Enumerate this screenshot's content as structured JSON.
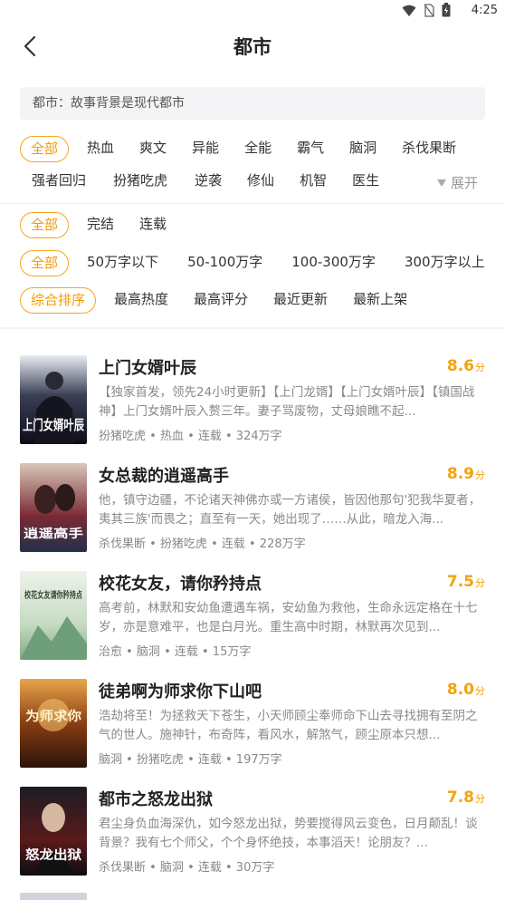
{
  "status": {
    "time": "4:25"
  },
  "header": {
    "title": "都市"
  },
  "description": "都市：故事背景是现代都市",
  "genre_tags": [
    "全部",
    "热血",
    "爽文",
    "异能",
    "全能",
    "霸气",
    "脑洞",
    "杀伐果断",
    "强者回归",
    "扮猪吃虎",
    "逆袭",
    "修仙",
    "机智",
    "医生"
  ],
  "expand_label": "展开",
  "status_filters": [
    "全部",
    "完结",
    "连载"
  ],
  "length_filters": [
    "全部",
    "50万字以下",
    "50-100万字",
    "100-300万字",
    "300万字以上"
  ],
  "sort_filters": [
    "综合排序",
    "最高热度",
    "最高评分",
    "最近更新",
    "最新上架"
  ],
  "score_unit": "分",
  "books": [
    {
      "title": "上门女婿叶辰",
      "score": "8.6",
      "desc": "【独家首发，领先24小时更新】【上门龙婿】【上门女婿叶辰】【镇国战神】上门女婿叶辰入赘三年。妻子骂废物，丈母娘瞧不起...",
      "meta": "扮猪吃虎 • 热血 • 连载 • 324万字",
      "cover_text": "上门女婿叶辰"
    },
    {
      "title": "女总裁的逍遥高手",
      "score": "8.9",
      "desc": "他，镇守边疆，不论诸天神佛亦或一方诸侯，皆因他那句'犯我华夏者，夷其三族'而畏之；直至有一天，她出现了……从此，暗龙入海...",
      "meta": "杀伐果断 • 扮猪吃虎 • 连载 • 228万字",
      "cover_text": "逍遥高手"
    },
    {
      "title": "校花女友，请你矜持点",
      "score": "7.5",
      "desc": "高考前，林默和安幼鱼遭遇车祸，安幼鱼为救他，生命永远定格在十七岁，亦是意难平，也是白月光。重生高中时期，林默再次见到...",
      "meta": "治愈 • 脑洞 • 连载 • 15万字",
      "cover_text": "校花女友请你矜持点"
    },
    {
      "title": "徒弟啊为师求你下山吧",
      "score": "8.0",
      "desc": "浩劫将至！为拯救天下苍生，小天师顾尘奉师命下山去寻找拥有至阴之气的世人。施神针，布奇阵，看风水，解煞气，顾尘原本只想...",
      "meta": "脑洞 • 扮猪吃虎 • 连载 • 197万字",
      "cover_text": "为师求你"
    },
    {
      "title": "都市之怒龙出狱",
      "score": "7.8",
      "desc": "君尘身负血海深仇，如今怒龙出狱，势要搅得风云变色，日月颠乱！谈背景？我有七个师父，个个身怀绝技，本事滔天！论朋友？...",
      "meta": "杀伐果断 • 脑洞 • 连载 • 30万字",
      "cover_text": "怒龙出狱"
    }
  ]
}
